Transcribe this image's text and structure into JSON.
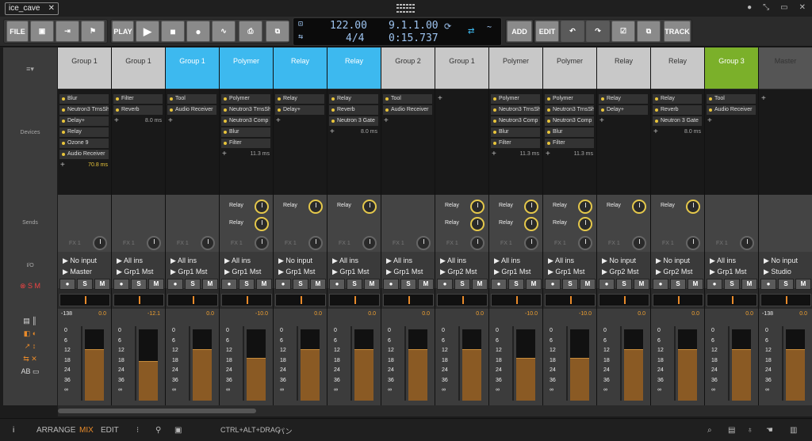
{
  "window": {
    "tab_label": "ice_cave",
    "close_glyph": "✕",
    "controls": [
      "●",
      "⤡",
      "▭",
      "✕"
    ]
  },
  "toolbar": {
    "file": "FILE",
    "play": "PLAY",
    "add": "ADD",
    "edit": "EDIT",
    "track": "TRACK"
  },
  "transport": {
    "tempo": "122.00",
    "signature": "4/4",
    "position": "9.1.1.00",
    "time": "0:15.737"
  },
  "sidebar": {
    "devices": "Devices",
    "sends": "Sends",
    "io": "I/O"
  },
  "channels": [
    {
      "name": "Group 1",
      "color": "#c8c8c8",
      "devices": [
        "Blur",
        "Neutron3 TrnsSh",
        "Delay+",
        "Relay",
        "Ozone 9",
        "Audio Receiver"
      ],
      "latency": "70.8 ms",
      "sends": [],
      "fx": "FX 1",
      "input": "No input",
      "output": "Master",
      "peak": "-138",
      "peakval": "0.0",
      "level": 0.72
    },
    {
      "name": "Group 1",
      "color": "#c8c8c8",
      "devices": [
        "Filter",
        "Reverb"
      ],
      "latency": "8.0 ms",
      "sends": [],
      "fx": "FX 1",
      "input": "All ins",
      "output": "Grp1 Mst",
      "peak": "",
      "peakval": "-12.1",
      "level": 0.56
    },
    {
      "name": "Group 1",
      "color": "#3db9ef",
      "devices": [
        "Tool",
        "Audio Receiver"
      ],
      "latency": "",
      "sends": [],
      "fx": "FX 1",
      "input": "All ins",
      "output": "Grp1 Mst",
      "peak": "",
      "peakval": "0.0",
      "level": 0.72
    },
    {
      "name": "Polymer",
      "color": "#3db9ef",
      "devices": [
        "Polymer",
        "Neutron3 TrnsSh",
        "Neutron3 Comp",
        "Blur",
        "Filter"
      ],
      "latency": "11.3 ms",
      "sends": [
        "Relay",
        "Relay"
      ],
      "fx": "FX 1",
      "input": "All ins",
      "output": "Grp1 Mst",
      "peak": "",
      "peakval": "-10.0",
      "level": 0.6
    },
    {
      "name": "Relay",
      "color": "#3db9ef",
      "devices": [
        "Relay",
        "Delay+"
      ],
      "latency": "",
      "sends": [
        "Relay"
      ],
      "fx": "FX 1",
      "input": "No input",
      "output": "Grp1 Mst",
      "peak": "",
      "peakval": "0.0",
      "level": 0.72
    },
    {
      "name": "Relay",
      "color": "#3db9ef",
      "devices": [
        "Relay",
        "Reverb",
        "Neutron 3 Gate"
      ],
      "latency": "8.0 ms",
      "sends": [
        "Relay"
      ],
      "fx": "FX 1",
      "input": "All ins",
      "output": "Grp1 Mst",
      "peak": "",
      "peakval": "0.0",
      "level": 0.72
    },
    {
      "name": "Group 2",
      "color": "#c8c8c8",
      "devices": [
        "Tool",
        "Audio Receiver"
      ],
      "latency": "",
      "sends": [],
      "fx": "FX 1",
      "input": "All ins",
      "output": "Grp1 Mst",
      "peak": "",
      "peakval": "0.0",
      "level": 0.72
    },
    {
      "name": "Group 1",
      "color": "#c8c8c8",
      "devices": [],
      "latency": "",
      "sends": [
        "Relay",
        "Relay"
      ],
      "fx": "FX 1",
      "input": "All ins",
      "output": "Grp2 Mst",
      "peak": "",
      "peakval": "0.0",
      "level": 0.72
    },
    {
      "name": "Polymer",
      "color": "#c8c8c8",
      "devices": [
        "Polymer",
        "Neutron3 TrnsSh",
        "Neutron3 Comp",
        "Blur",
        "Filter"
      ],
      "latency": "11.3 ms",
      "sends": [
        "Relay",
        "Relay"
      ],
      "fx": "FX 1",
      "input": "All ins",
      "output": "Grp1 Mst",
      "peak": "",
      "peakval": "-10.0",
      "level": 0.6
    },
    {
      "name": "Polymer",
      "color": "#c8c8c8",
      "devices": [
        "Polymer",
        "Neutron3 TrnsSh",
        "Neutron3 Comp",
        "Blur",
        "Filter"
      ],
      "latency": "11.3 ms",
      "sends": [
        "Relay",
        "Relay"
      ],
      "fx": "FX 1",
      "input": "All ins",
      "output": "Grp1 Mst",
      "peak": "",
      "peakval": "-10.0",
      "level": 0.6
    },
    {
      "name": "Relay",
      "color": "#c8c8c8",
      "devices": [
        "Relay",
        "Delay+"
      ],
      "latency": "",
      "sends": [
        "Relay"
      ],
      "fx": "FX 1",
      "input": "No input",
      "output": "Grp2 Mst",
      "peak": "",
      "peakval": "0.0",
      "level": 0.72
    },
    {
      "name": "Relay",
      "color": "#c8c8c8",
      "devices": [
        "Relay",
        "Reverb",
        "Neutron 3 Gate"
      ],
      "latency": "8.0 ms",
      "sends": [
        "Relay"
      ],
      "fx": "FX 1",
      "input": "No input",
      "output": "Grp2 Mst",
      "peak": "",
      "peakval": "0.0",
      "level": 0.72
    },
    {
      "name": "Group 3",
      "color": "#7bb02a",
      "devices": [
        "Tool",
        "Audio Receiver"
      ],
      "latency": "",
      "sends": [],
      "fx": "FX 1",
      "input": "All ins",
      "output": "Grp1 Mst",
      "peak": "",
      "peakval": "0.0",
      "level": 0.72
    },
    {
      "name": "Master",
      "color": "#555555",
      "devices": [],
      "latency": "",
      "sends": [],
      "fx": "",
      "input": "No input",
      "output": "Studio",
      "peak": "-138",
      "peakval": "0.0",
      "level": 0.72
    }
  ],
  "meter_scale": [
    "0",
    "6",
    "12",
    "18",
    "24",
    "36",
    "∞"
  ],
  "status": {
    "arrange": "ARRANGE",
    "mix": "MIX",
    "edit": "EDIT",
    "hint": "CTRL+ALT+DRAG",
    "hint_action": "パン"
  }
}
